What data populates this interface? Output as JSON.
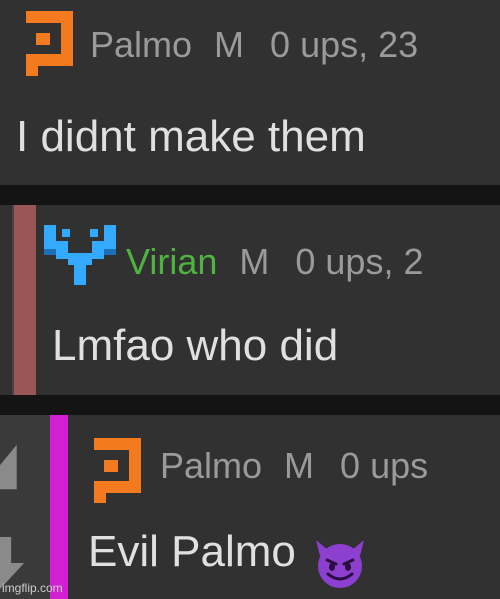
{
  "comments": [
    {
      "username": "Palmo",
      "gender": "M",
      "meta": "0 ups, 23",
      "text": "I didnt make them",
      "avatar": "palmo-orange-logo",
      "accent": "#f47a1f"
    },
    {
      "username": "Virian",
      "gender": "M",
      "meta": "0 ups, 2",
      "text": "Lmfao who did",
      "avatar": "virian-blue-logo",
      "accent": "#33aaff",
      "name_color": "#4fb341",
      "thread_color": "#9a5555"
    },
    {
      "username": "Palmo",
      "gender": "M",
      "meta": "0 ups",
      "text": "Evil Palmo",
      "emoji": "smiling-devil-emoji",
      "avatar": "palmo-orange-logo",
      "accent": "#f47a1f",
      "thread_color": "#d21fd2"
    }
  ],
  "watermark": "imgflip.com"
}
